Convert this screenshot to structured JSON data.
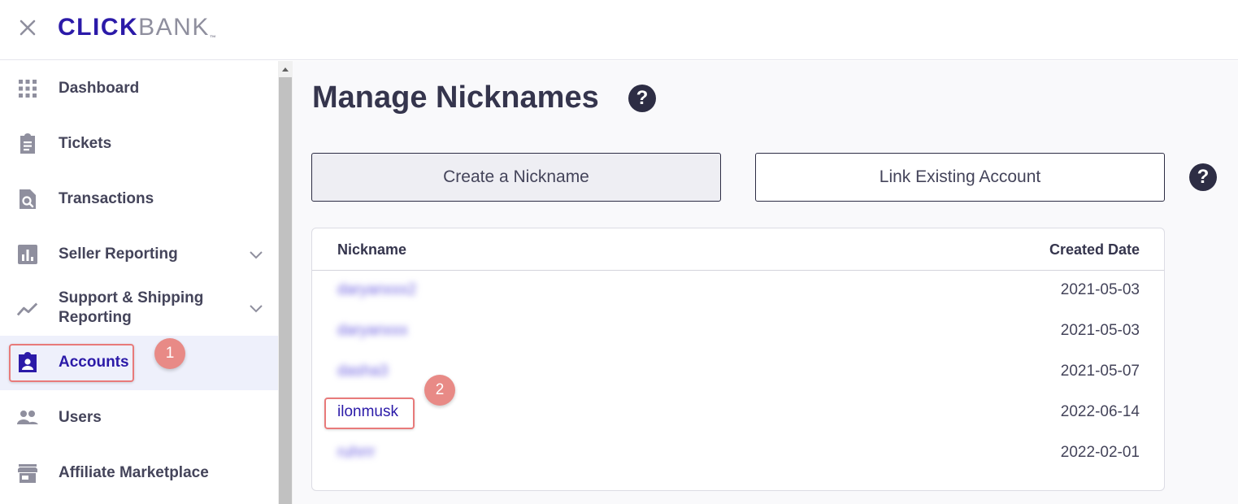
{
  "brand": {
    "name_left": "CLICK",
    "name_right": "BANK",
    "trademark": "™",
    "accent_color": "#2b1aa8"
  },
  "sidebar": {
    "items": [
      {
        "label": "Dashboard",
        "icon": "grid-icon",
        "active": false
      },
      {
        "label": "Tickets",
        "icon": "clipboard-icon",
        "active": false
      },
      {
        "label": "Transactions",
        "icon": "file-search-icon",
        "active": false
      },
      {
        "label": "Seller Reporting",
        "icon": "bar-chart-icon",
        "active": false,
        "expandable": true
      },
      {
        "label": "Support & Shipping Reporting",
        "icon": "trend-line-icon",
        "active": false,
        "expandable": true
      },
      {
        "label": "Accounts",
        "icon": "account-badge-icon",
        "active": true
      },
      {
        "label": "Users",
        "icon": "users-icon",
        "active": false
      },
      {
        "label": "Affiliate Marketplace",
        "icon": "storefront-icon",
        "active": false
      }
    ]
  },
  "main": {
    "title": "Manage Nicknames",
    "help_symbol": "?",
    "create_button": "Create a Nickname",
    "link_button": "Link Existing Account",
    "table": {
      "columns": [
        "Nickname",
        "Created Date"
      ],
      "rows": [
        {
          "nickname": "daryanxxx2",
          "date": "2021-05-03",
          "blurred": true
        },
        {
          "nickname": "daryanxxx",
          "date": "2021-05-03",
          "blurred": true
        },
        {
          "nickname": "dasha3",
          "date": "2021-05-07",
          "blurred": true
        },
        {
          "nickname": "ilonmusk",
          "date": "2022-06-14",
          "blurred": false
        },
        {
          "nickname": "ruhrrr",
          "date": "2022-02-01",
          "blurred": true
        }
      ]
    }
  },
  "annotations": {
    "badge_1": "1",
    "badge_2": "2",
    "color": "#e87a7a"
  }
}
